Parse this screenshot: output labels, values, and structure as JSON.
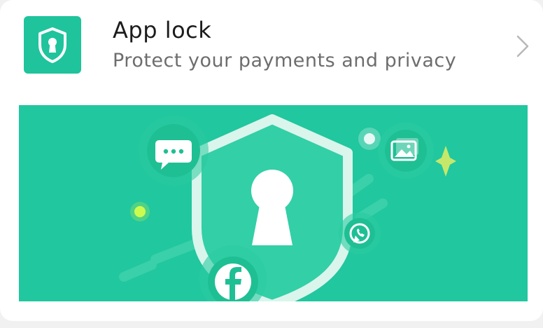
{
  "item": {
    "title": "App lock",
    "subtitle": "Protect your payments and privacy",
    "icon": "shield-keyhole-icon",
    "trailing_icon": "chevron-right-icon"
  },
  "banner": {
    "illustration": "shield-with-keyhole",
    "floating_icons": [
      "chat-bubble-icon",
      "gallery-icon",
      "phone-call-icon",
      "facebook-icon"
    ]
  },
  "colors": {
    "accent": "#1fc49c",
    "banner_bg": "#21c79e",
    "title": "#1c1c1c",
    "subtitle": "#6d6d6d"
  }
}
